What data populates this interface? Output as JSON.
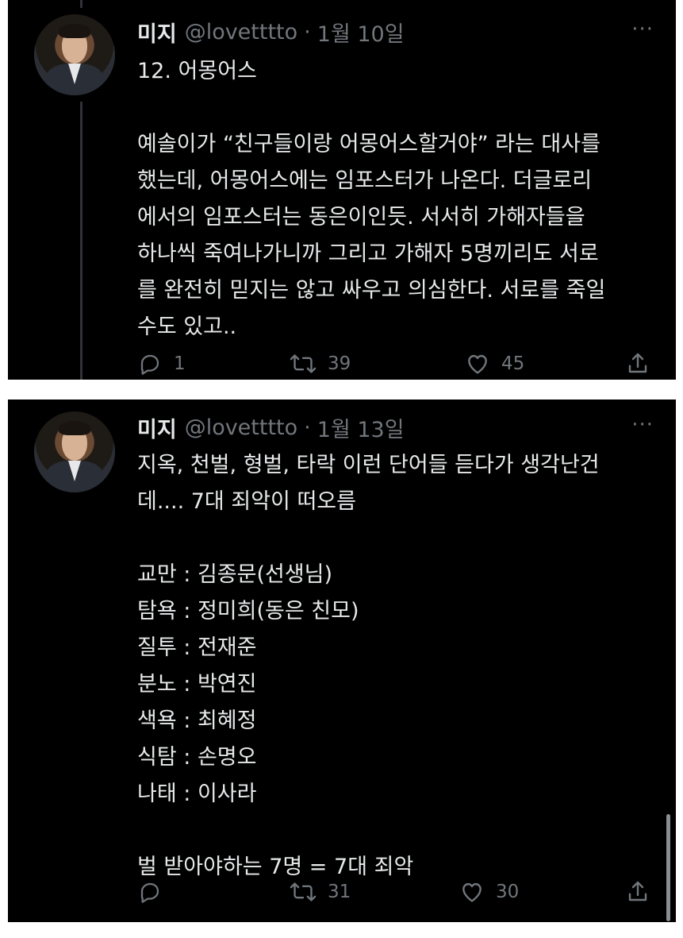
{
  "tweets": [
    {
      "name": "미지",
      "handle": "@lovetttto",
      "date_sep": "·",
      "date": "1월 10일",
      "more": "···",
      "lines": [
        "12. 어몽어스",
        "",
        "예솔이가 “친구들이랑 어몽어스할거야” 라는 대사를",
        "했는데, 어몽어스에는 임포스터가 나온다. 더글로리",
        "에서의 임포스터는 동은이인듯. 서서히 가해자들을",
        "하나씩 죽여나가니까 그리고 가해자 5명끼리도 서로",
        "를 완전히 믿지는 않고 싸우고 의심한다. 서로를 죽일",
        "수도 있고.."
      ],
      "reply_icon": "reply-icon",
      "reply_count": "1",
      "retweet_icon": "retweet-icon",
      "retweet_count": "39",
      "like_icon": "heart-icon",
      "like_count": "45",
      "share_icon": "share-icon"
    },
    {
      "name": "미지",
      "handle": "@lovetttto",
      "date_sep": "·",
      "date": "1월 13일",
      "more": "···",
      "lines": [
        "지옥, 천벌, 형벌, 타락 이런 단어들 듣다가 생각난건",
        "데.... 7대 죄악이 떠오름",
        "",
        "교만 : 김종문(선생님)",
        "탐욕 : 정미희(동은 친모)",
        "질투 : 전재준",
        "분노 : 박연진",
        "색욕 : 최혜정",
        "식탐 : 손명오",
        "나태 : 이사라",
        "",
        "벌 받아야하는 7명 = 7대 죄악"
      ],
      "reply_icon": "reply-icon",
      "reply_count": "",
      "retweet_icon": "retweet-icon",
      "retweet_count": "31",
      "like_icon": "heart-icon",
      "like_count": "30",
      "share_icon": "share-icon"
    }
  ],
  "colors": {
    "background": "#000000",
    "text": "#e7e9ea",
    "muted": "#71767b",
    "page": "#ffffff"
  }
}
